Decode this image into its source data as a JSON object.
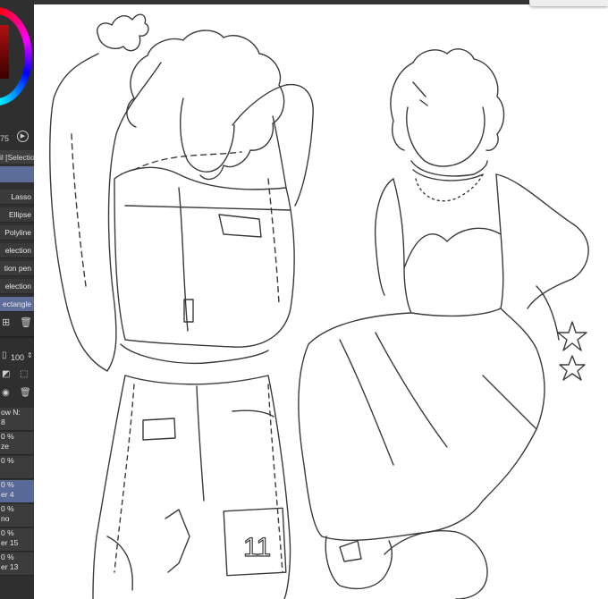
{
  "app": {
    "accent": "#5a6a98",
    "panel_bg": "#2f2f2f"
  },
  "color": {
    "value_fragment": "75"
  },
  "subtool_header": "il [Selection",
  "tools": [
    {
      "label": "Lasso",
      "active": false
    },
    {
      "label": "Ellipse",
      "active": false
    },
    {
      "label": "Polyline",
      "active": false
    },
    {
      "label": "election",
      "active": false
    },
    {
      "label": "tion pen",
      "active": false
    },
    {
      "label": "election",
      "active": false
    },
    {
      "label": "ectangle",
      "active": true
    }
  ],
  "layer_panel": {
    "opacity": "100",
    "layers": [
      {
        "line1": "ow N:",
        "line2": "8",
        "selected": false
      },
      {
        "line1": "0 %",
        "line2": "ze",
        "selected": false
      },
      {
        "line1": "0 %",
        "line2": "",
        "selected": false
      },
      {
        "line1": "0 %",
        "line2": "er 4",
        "selected": true
      },
      {
        "line1": "0 %",
        "line2": "no",
        "selected": false
      },
      {
        "line1": "0 %",
        "line2": "er 15",
        "selected": false
      },
      {
        "line1": "0 %",
        "line2": "er 13",
        "selected": false
      }
    ]
  },
  "artwork": {
    "jersey_number": "11"
  }
}
